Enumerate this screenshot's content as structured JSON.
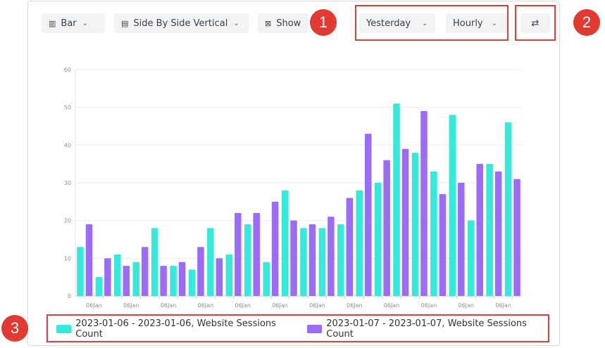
{
  "toolbar": {
    "chart_type": "Bar",
    "layout": "Side By Side Vertical",
    "show": "Show",
    "date_range": "Yesterday",
    "interval": "Hourly",
    "swap_icon": "⇄"
  },
  "annotations": [
    "1",
    "2",
    "3"
  ],
  "colors": {
    "series1": "#33eadb",
    "series2": "#9c6cf8",
    "callout": "#e23a30"
  },
  "chart_data": {
    "type": "bar",
    "ylim": [
      0,
      60
    ],
    "yticks": [
      "0",
      "10",
      "20",
      "30",
      "40",
      "50",
      "60"
    ],
    "categories": [
      "06Jan",
      "06Jan",
      "06Jan",
      "06Jan",
      "06Jan",
      "06Jan",
      "06Jan",
      "06Jan",
      "06Jan",
      "06Jan",
      "06Jan",
      "06Jan",
      "06Jan",
      "06Jan",
      "06Jan",
      "06Jan",
      "06Jan",
      "06Jan",
      "06Jan",
      "06Jan",
      "06Jan",
      "06Jan",
      "06Jan",
      "06Jan"
    ],
    "series": [
      {
        "name": "2023-01-06 - 2023-01-06,  Website Sessions Count",
        "color": "#33eadb",
        "values": [
          13,
          5,
          11,
          9,
          18,
          8,
          7,
          18,
          11,
          19,
          9,
          28,
          18,
          18,
          19,
          28,
          30,
          51,
          38,
          33,
          48,
          20,
          35,
          46
        ]
      },
      {
        "name": "2023-01-07 - 2023-01-07,  Website Sessions Count",
        "color": "#9c6cf8",
        "values": [
          19,
          10,
          8,
          13,
          8,
          9,
          13,
          10,
          22,
          22,
          25,
          20,
          19,
          21,
          26,
          43,
          36,
          39,
          49,
          27,
          30,
          35,
          33,
          31
        ]
      }
    ],
    "grid": true,
    "legend": "bottom"
  }
}
